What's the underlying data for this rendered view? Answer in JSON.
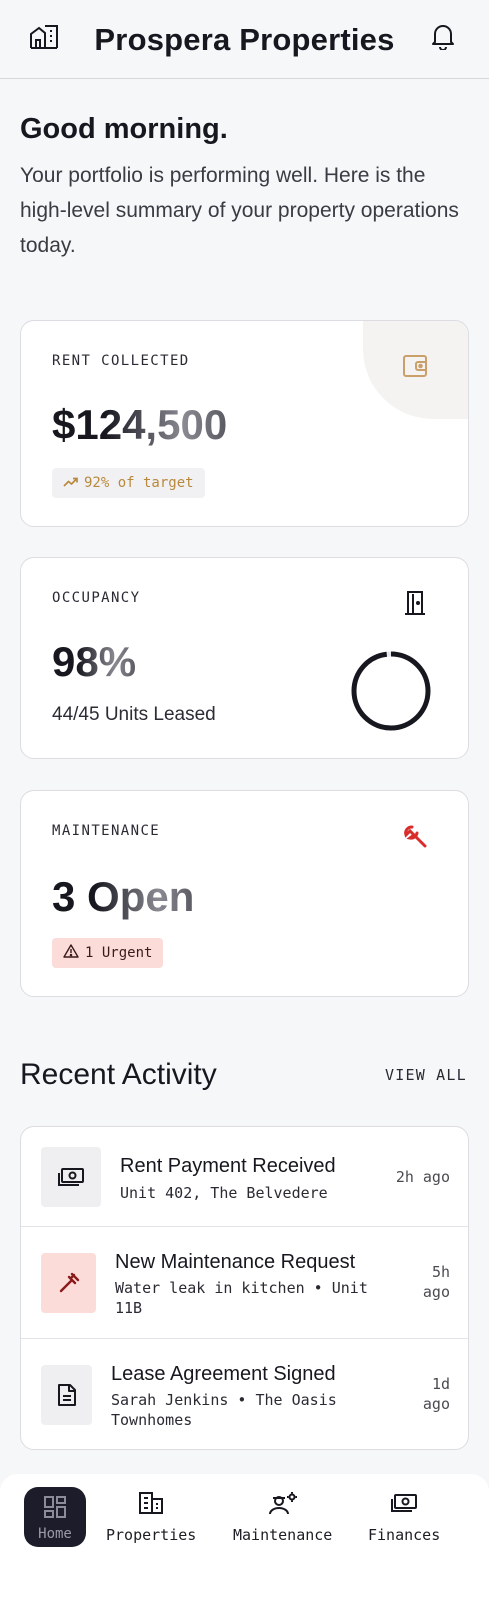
{
  "header": {
    "title": "Prospera Properties",
    "logo_icon": "building-outline-icon",
    "bell_icon": "bell-icon"
  },
  "greeting": {
    "title": "Good morning.",
    "body": "Your portfolio is performing well. Here is the high-level summary of your property operations today."
  },
  "cards": {
    "rent": {
      "label": "RENT COLLECTED",
      "value": "$124,500",
      "badge": "92% of target",
      "icon": "wallet-icon",
      "accent": "#c9a06a"
    },
    "occupancy": {
      "label": "OCCUPANCY",
      "value": "98%",
      "units": "44/45 Units Leased",
      "icon": "door-icon",
      "progress": 0.98
    },
    "maintenance": {
      "label": "MAINTENANCE",
      "value": "3 Open",
      "badge": "1 Urgent",
      "icon": "wrench-icon",
      "accent": "#d92d2d"
    }
  },
  "activity": {
    "title": "Recent Activity",
    "view_all": "VIEW ALL",
    "items": [
      {
        "title": "Rent Payment Received",
        "subtitle": "Unit 402, The Belvedere",
        "time": "2h ago",
        "icon": "cash-icon"
      },
      {
        "title": "New Maintenance Request",
        "subtitle": "Water leak in kitchen • Unit 11B",
        "time": "5h ago",
        "icon": "plumbing-icon"
      },
      {
        "title": "Lease Agreement Signed",
        "subtitle": "Sarah Jenkins • The Oasis Townhomes",
        "time": "1d ago",
        "icon": "document-icon"
      }
    ]
  },
  "nav": {
    "items": [
      {
        "label": "Home",
        "icon": "dashboard-icon",
        "active": true
      },
      {
        "label": "Properties",
        "icon": "building-icon"
      },
      {
        "label": "Maintenance",
        "icon": "engineer-icon"
      },
      {
        "label": "Finances",
        "icon": "cash-icon"
      }
    ]
  },
  "colors": {
    "background": "#f6f7f9",
    "text": "#17171f",
    "urgent_bg": "#fbdcd8",
    "nav_active": "#1c1c2a"
  }
}
